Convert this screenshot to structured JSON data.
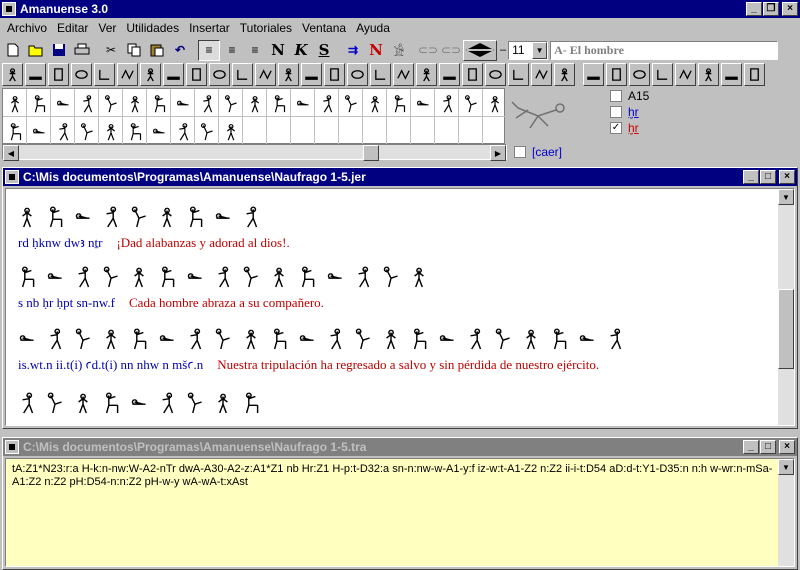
{
  "app": {
    "title": "Amanuense 3.0"
  },
  "menu": [
    "Archivo",
    "Editar",
    "Ver",
    "Utilidades",
    "Insertar",
    "Tutoriales",
    "Ventana",
    "Ayuda"
  ],
  "toolbar": {
    "font_size": "11",
    "sign_field": "A- El hombre"
  },
  "checklist": [
    {
      "label": "A15",
      "checked": false,
      "color": "#000000"
    },
    {
      "label": "ḫr",
      "checked": false,
      "color": "#0000cc"
    },
    {
      "label": "ḫr",
      "checked": true,
      "color": "#cc0000"
    }
  ],
  "caer_label": "[caer]",
  "editor": {
    "title": "C:\\Mis documentos\\Programas\\Amanuense\\Naufrago 1-5.jer",
    "lines": [
      {
        "translit": "rd ḥknw dwꜣ nṯr",
        "translation": "¡Dad alabanzas y adorad al dios!."
      },
      {
        "translit": "s nb ḥr ḥpt sn-nw.f",
        "translation": "Cada hombre abraza a su compañero."
      },
      {
        "translit": "is.wt.n ii.t(i) ꜥd.t(i) nn nhw n mšꜥ.n",
        "translation": "Nuestra tripulación ha regresado a salvo y sin pérdida de nuestro ejército."
      }
    ]
  },
  "transcript": {
    "title": "C:\\Mis documentos\\Programas\\Amanuense\\Naufrago 1-5.tra",
    "text": "tA:Z1*N23:r:a H-k:n-nw:W-A2-nTr dwA-A30-A2-z:A1*Z1 nb Hr:Z1 H-p:t-D32:a sn-n:nw-w-A1-y:f iz-w:t-A1-Z2 n:Z2 ii-i-t:D54 aD:d-t:Y1-D35:n n:h w-wr:n-mSa-A1:Z2 n:Z2 pH:D54-n:n:Z2 pH-w-y wA-wA-t:xAst"
  }
}
